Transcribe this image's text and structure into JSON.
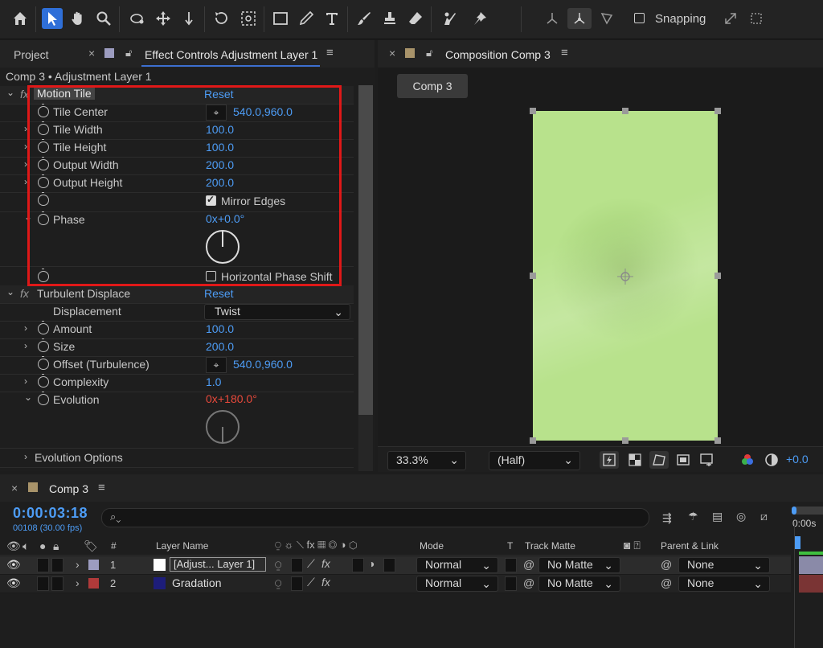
{
  "toolbar": {
    "snapping_label": "Snapping"
  },
  "left_panel": {
    "tab_project": "Project",
    "tab_effect_controls": "Effect Controls Adjustment Layer 1",
    "breadcrumb": "Comp 3 • Adjustment Layer 1",
    "effects": [
      {
        "name": "Motion Tile",
        "reset": "Reset",
        "props": [
          {
            "label": "Tile Center",
            "value": "540.0,960.0"
          },
          {
            "label": "Tile Width",
            "value": "100.0"
          },
          {
            "label": "Tile Height",
            "value": "100.0"
          },
          {
            "label": "Output Width",
            "value": "200.0"
          },
          {
            "label": "Output Height",
            "value": "200.0"
          },
          {
            "label": "Mirror Edges",
            "value": "checked"
          },
          {
            "label": "Phase",
            "value_x": "0x",
            "value_deg": "+0.0°"
          },
          {
            "label": "Horizontal Phase Shift",
            "value": "unchecked"
          }
        ]
      },
      {
        "name": "Turbulent Displace",
        "reset": "Reset",
        "props": [
          {
            "label": "Displacement",
            "value": "Twist"
          },
          {
            "label": "Amount",
            "value": "100.0"
          },
          {
            "label": "Size",
            "value": "200.0"
          },
          {
            "label": "Offset (Turbulence)",
            "value": "540.0,960.0"
          },
          {
            "label": "Complexity",
            "value": "1.0"
          },
          {
            "label": "Evolution",
            "value_x": "0x",
            "value_deg": "+180.0°"
          }
        ]
      }
    ],
    "evolution_options": "Evolution Options"
  },
  "comp_panel": {
    "tab_title": "Composition Comp 3",
    "comp_button": "Comp 3",
    "zoom": "33.3%",
    "resolution": "(Half)",
    "exposure": "+0.0"
  },
  "timeline": {
    "tab_title": "Comp 3",
    "timecode": "0:00:03:18",
    "frame_info": "00108 (30.00 fps)",
    "search_placeholder": "",
    "ruler_label": "0:00s",
    "columns": {
      "hash": "#",
      "layer_name": "Layer Name",
      "mode": "Mode",
      "t": "T",
      "track_matte": "Track Matte",
      "parent_link": "Parent & Link"
    },
    "layers": [
      {
        "index": "1",
        "name": "[Adjust... Layer 1]",
        "label_color": "#9c9cc0",
        "swatch": "#ffffff",
        "mode": "Normal",
        "matte": "No Matte",
        "parent": "None"
      },
      {
        "index": "2",
        "name": "Gradation",
        "label_color": "#b03a3a",
        "swatch": "#1d1d7a",
        "mode": "Normal",
        "matte": "No Matte",
        "parent": "None"
      }
    ]
  },
  "colors": {
    "accent_blue": "#4d9cf5",
    "keyframe_red": "#e8493b",
    "highlight_box": "#e01818",
    "canvas_green": "#b7e08a"
  }
}
